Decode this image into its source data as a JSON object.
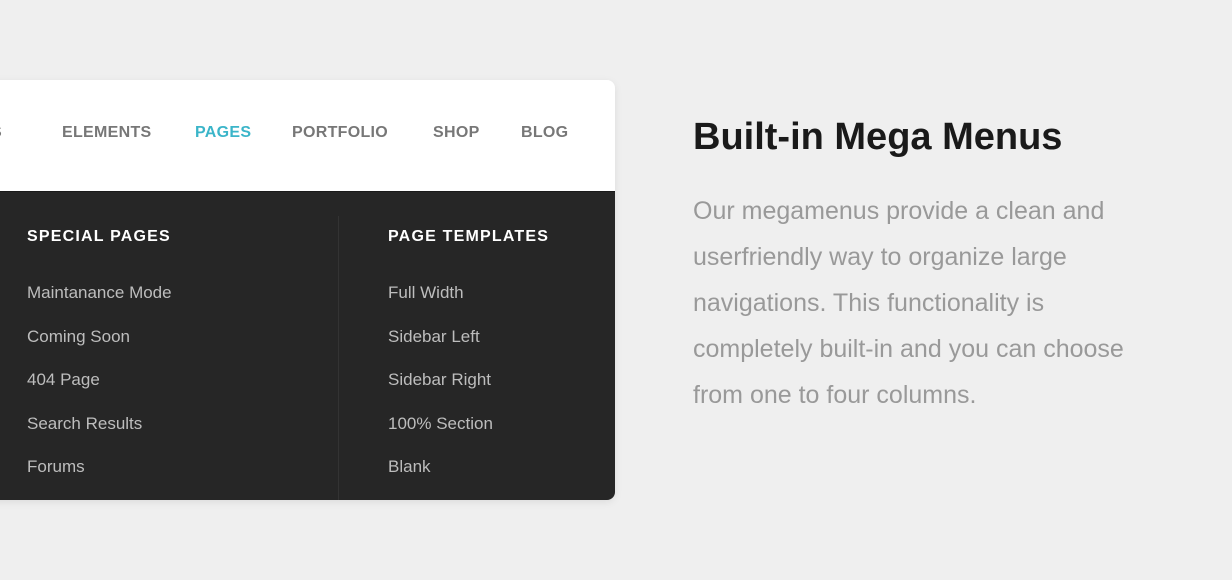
{
  "nav": {
    "items": [
      {
        "label": "ES",
        "active": false
      },
      {
        "label": "ELEMENTS",
        "active": false
      },
      {
        "label": "PAGES",
        "active": true
      },
      {
        "label": "PORTFOLIO",
        "active": false
      },
      {
        "label": "SHOP",
        "active": false
      },
      {
        "label": "BLOG",
        "active": false
      }
    ],
    "accent_color": "#3bb5c9"
  },
  "mega_menu": {
    "columns": [
      {
        "heading": "SPECIAL PAGES",
        "items": [
          "Maintanance Mode",
          "Coming Soon",
          "404 Page",
          "Search Results",
          "Forums"
        ]
      },
      {
        "heading": "PAGE TEMPLATES",
        "items": [
          "Full Width",
          "Sidebar Left",
          "Sidebar Right",
          "100% Section",
          "Blank"
        ]
      }
    ]
  },
  "feature": {
    "title": "Built-in Mega Menus",
    "description": "Our megamenus provide a clean and userfriendly way to organize large navigations. This functionality is completely built-in and you can choose from one to four columns."
  }
}
